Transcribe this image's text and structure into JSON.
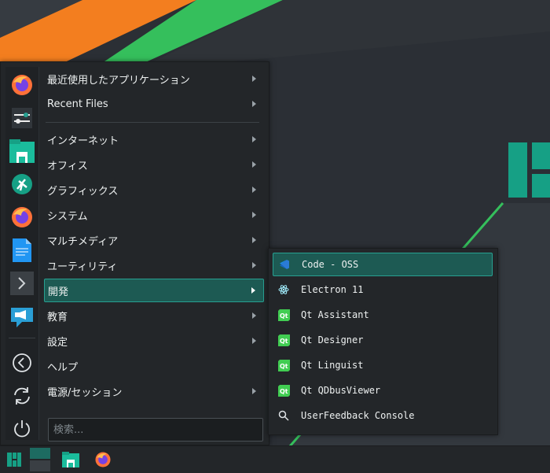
{
  "menu": {
    "categories": [
      {
        "label": "最近使用したアプリケーション"
      },
      {
        "label": "Recent Files"
      },
      {
        "label": "インターネット"
      },
      {
        "label": "オフィス"
      },
      {
        "label": "グラフィックス"
      },
      {
        "label": "システム"
      },
      {
        "label": "マルチメディア"
      },
      {
        "label": "ユーティリティ"
      },
      {
        "label": "開発"
      },
      {
        "label": "教育"
      },
      {
        "label": "設定"
      },
      {
        "label": "ヘルプ"
      },
      {
        "label": "電源/セッション"
      }
    ],
    "active_category": "開発",
    "search_placeholder": "検索..."
  },
  "submenu": {
    "items": [
      {
        "label": "Code - OSS",
        "icon": "vscode-icon"
      },
      {
        "label": "Electron 11",
        "icon": "electron-icon"
      },
      {
        "label": "Qt Assistant",
        "icon": "qt-icon"
      },
      {
        "label": "Qt Designer",
        "icon": "qt-icon"
      },
      {
        "label": "Qt Linguist",
        "icon": "qt-icon"
      },
      {
        "label": "Qt QDbusViewer",
        "icon": "qt-icon"
      },
      {
        "label": "UserFeedback Console",
        "icon": "search-icon"
      }
    ]
  },
  "favorites": [
    "firefox-icon",
    "system-settings-icon",
    "file-manager-icon",
    "octopi-icon",
    "firefox-icon",
    "text-editor-icon",
    "terminal-icon",
    "chat-icon",
    "back-icon",
    "refresh-icon",
    "power-icon"
  ],
  "taskbar": [
    "manjaro-logo-icon",
    "desktop-pager-icon",
    "file-manager-icon",
    "firefox-icon"
  ],
  "colors": {
    "accent": "#27a091",
    "highlight": "#1d5a53",
    "orange": "#f37e1f",
    "green": "#35bf5c",
    "logo": "#16a085"
  }
}
